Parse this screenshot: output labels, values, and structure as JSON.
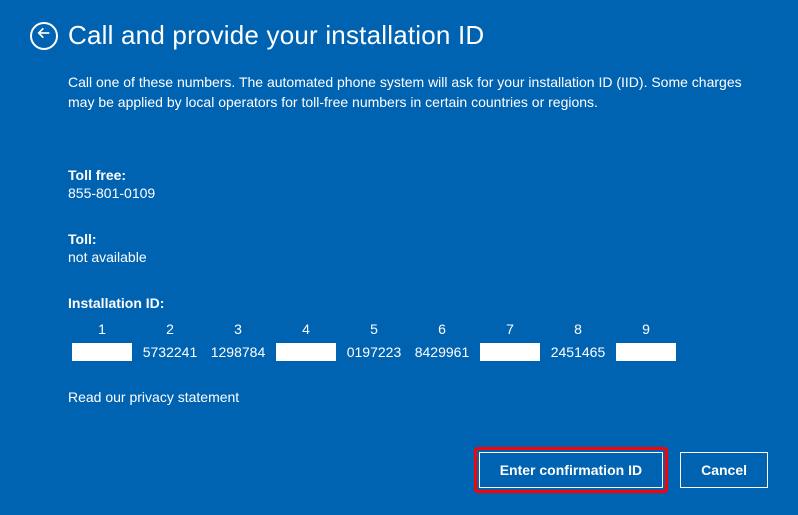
{
  "header": {
    "title": "Call and provide your installation ID"
  },
  "description": "Call one of these numbers. The automated phone system will ask for your installation ID (IID). Some charges may be applied by local operators for toll-free numbers in certain countries or regions.",
  "toll_free": {
    "label": "Toll free:",
    "value": "855-801-0109"
  },
  "toll": {
    "label": "Toll:",
    "value": "not available"
  },
  "installation": {
    "label": "Installation ID:",
    "columns": [
      "1",
      "2",
      "3",
      "4",
      "5",
      "6",
      "7",
      "8",
      "9"
    ],
    "values": [
      "",
      "5732241",
      "1298784",
      "",
      "0197223",
      "8429961",
      "",
      "2451465",
      ""
    ]
  },
  "privacy_link": "Read our privacy statement",
  "buttons": {
    "confirm": "Enter confirmation ID",
    "cancel": "Cancel"
  }
}
